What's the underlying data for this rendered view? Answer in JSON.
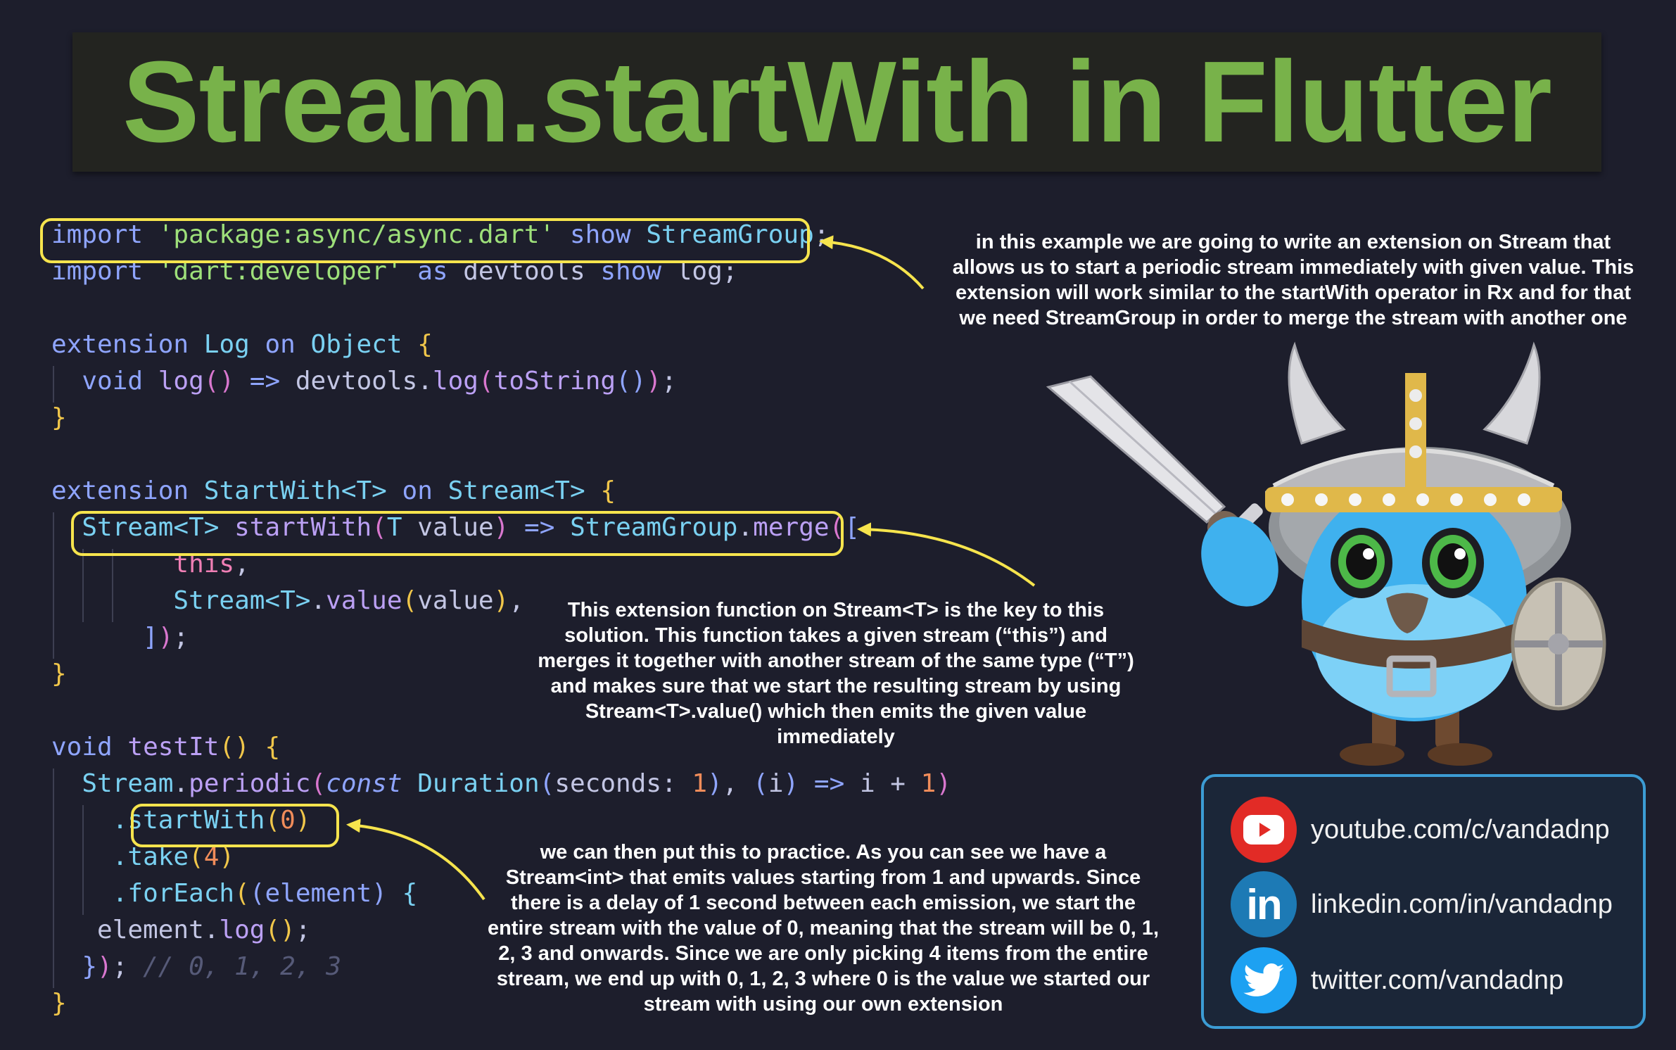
{
  "title": "Stream.startWith in Flutter",
  "code": {
    "line1": {
      "kw1": "import",
      "str": "'package:async/async.dart'",
      "kw2": "show",
      "typ": "StreamGroup",
      "end": ";"
    },
    "line2": {
      "kw1": "import",
      "str": "'dart:developer'",
      "kw2": "as",
      "alias": "devtools",
      "kw3": "show",
      "ident": "log",
      "end": ";"
    },
    "line4": {
      "kw1": "extension",
      "name": "Log",
      "kw2": "on",
      "typ": "Object",
      "brace": "{"
    },
    "line5": {
      "kw": "void",
      "fn": "log",
      "paren": "()",
      "arrow": "=>",
      "obj": "devtools.",
      "fn2": "log",
      "open": "(",
      "fn3": "toString",
      "inner": "()",
      "close": ")",
      "end": ";"
    },
    "line6": {
      "brace": "}"
    },
    "line8": {
      "kw1": "extension",
      "name": "StartWith<T>",
      "kw2": "on",
      "typ": "Stream<T>",
      "brace": "{"
    },
    "line9": {
      "typ": "Stream<T>",
      "fn": "startWith",
      "open": "(",
      "param_type": "T",
      "param": "value",
      "close": ")",
      "arrow": "=>",
      "typ2": "StreamGroup",
      "dot": ".",
      "fn2": "merge",
      "open2": "(",
      "bracket": "["
    },
    "line10": {
      "kw": "this",
      "end": ","
    },
    "line11": {
      "typ": "Stream<T>",
      "dot": ".",
      "fn": "value",
      "open": "(",
      "arg": "value",
      "close": ")",
      "end": ","
    },
    "line12": {
      "bracket": "]",
      "close": ")",
      "end": ";"
    },
    "line13": {
      "brace": "}"
    },
    "line15": {
      "kw": "void",
      "fn": "testIt",
      "paren": "()",
      "brace": "{"
    },
    "line16": {
      "typ": "Stream",
      "dot": ".",
      "fn": "periodic",
      "open": "(",
      "kw": "const",
      "typ2": "Duration",
      "open2": "(",
      "named": "seconds:",
      "num": "1",
      "close2": ")",
      "comma": ",",
      "lambda_open": "(",
      "lambda_param": "i",
      "lambda_close": ")",
      "arrow": "=>",
      "expr": "i + ",
      "num2": "1",
      "close": ")"
    },
    "line17": {
      "dot": ".",
      "fn": "startWith",
      "open": "(",
      "num": "0",
      "close": ")"
    },
    "line18": {
      "dot": ".",
      "fn": "take",
      "open": "(",
      "num": "4",
      "close": ")"
    },
    "line19": {
      "dot": ".",
      "fn": "forEach",
      "open": "(",
      "lambda": "(element)",
      "brace": "{"
    },
    "line20": {
      "ident": "element",
      "dot": ".",
      "fn": "log",
      "paren": "()",
      "end": ";"
    },
    "line21": {
      "brace": "}",
      "close": ")",
      "end": ";",
      "comment": "// 0, 1, 2, 3"
    },
    "line22": {
      "brace": "}"
    }
  },
  "notes": {
    "top": [
      "in this example we are going to write an extension on Stream that",
      "allows us to start a periodic stream immediately with given value. This",
      "extension will work similar to the startWith operator in Rx and for that",
      "we need StreamGroup in order to merge the stream with another one"
    ],
    "middle": [
      "This extension function on Stream<T> is the key to this",
      "solution. This function takes a given stream (“this”) and",
      "merges it together with another stream of the same type (“T”)",
      "and makes sure that we start the resulting stream by using",
      "Stream<T>.value() which then emits the given value",
      "immediately"
    ],
    "bottom": [
      "we can then put this to practice. As you can see we have a",
      "Stream<int> that emits values starting from 1 and upwards. Since",
      "there is a delay of 1 second between each emission, we start the",
      "entire stream with the value of 0, meaning that the stream will be 0, 1,",
      "2, 3 and onwards. Since we are only picking 4 items from the entire",
      "stream, we end up with 0, 1, 2, 3 where 0 is the value we started our",
      "stream with using our own extension"
    ]
  },
  "social": {
    "youtube": "youtube.com/c/vandadnp",
    "linkedin": "linkedin.com/in/vandadnp",
    "linkedin_glyph": "in",
    "twitter": "twitter.com/vandadnp"
  },
  "colors": {
    "background": "#1d1e2c",
    "title": "#78b24a",
    "highlight": "#f6e44d",
    "youtube": "#e22b26",
    "linkedin": "#1d7ab5",
    "twitter": "#1da1f2",
    "social_border": "#3c9cd4"
  }
}
